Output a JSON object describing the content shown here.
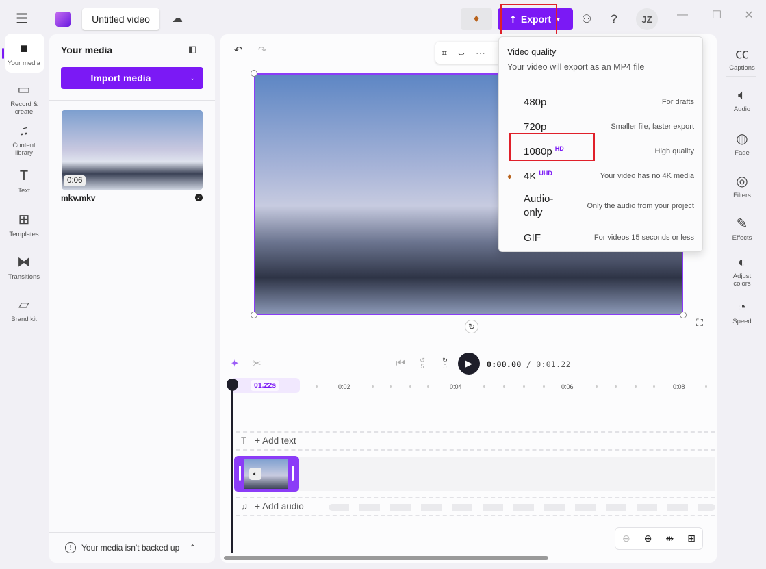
{
  "header": {
    "title": "Untitled video",
    "export_label": "Export",
    "avatar": "JZ",
    "help": "?"
  },
  "left_nav": [
    {
      "label": "Your media",
      "icon": "folder-icon"
    },
    {
      "label": "Record & create",
      "icon": "camera-icon"
    },
    {
      "label": "Content library",
      "icon": "library-icon"
    },
    {
      "label": "Text",
      "icon": "text-icon"
    },
    {
      "label": "Templates",
      "icon": "templates-icon"
    },
    {
      "label": "Transitions",
      "icon": "transitions-icon"
    },
    {
      "label": "Brand kit",
      "icon": "brand-kit-icon"
    }
  ],
  "media": {
    "title": "Your media",
    "import_label": "Import media",
    "items": [
      {
        "name": "mkv.mkv",
        "duration": "0:06"
      }
    ],
    "backup_notice": "Your media isn't backed up"
  },
  "export_menu": {
    "title": "Video quality",
    "subtitle": "Your video will export as an MP4 file",
    "options": [
      {
        "label": "480p",
        "badge": "",
        "desc": "For drafts"
      },
      {
        "label": "720p",
        "badge": "",
        "desc": "Smaller file, faster export"
      },
      {
        "label": "1080p",
        "badge": "HD",
        "desc": "High quality"
      },
      {
        "label": "4K",
        "badge": "UHD",
        "desc": "Your video has no 4K media"
      },
      {
        "label": "Audio-only",
        "badge": "",
        "desc": "Only the audio from your project"
      },
      {
        "label": "GIF",
        "badge": "",
        "desc": "For videos 15 seconds or less"
      }
    ]
  },
  "right_bar": [
    {
      "label": "Captions",
      "icon": "captions-icon"
    },
    {
      "label": "Audio",
      "icon": "audio-icon"
    },
    {
      "label": "Fade",
      "icon": "fade-icon"
    },
    {
      "label": "Filters",
      "icon": "filters-icon"
    },
    {
      "label": "Effects",
      "icon": "effects-icon"
    },
    {
      "label": "Adjust colors",
      "icon": "adjust-colors-icon"
    },
    {
      "label": "Speed",
      "icon": "speed-icon"
    }
  ],
  "timeline": {
    "current_time": "0:00.00",
    "total_time": "/ 0:01.22",
    "playhead_label": "01.22s",
    "ticks": [
      "0:02",
      "0:04",
      "0:06",
      "0:08"
    ],
    "add_text": "+ Add text",
    "add_audio": "+ Add audio",
    "skip_back": "5",
    "skip_fwd": "5"
  },
  "colors": {
    "accent": "#7b19f5"
  }
}
